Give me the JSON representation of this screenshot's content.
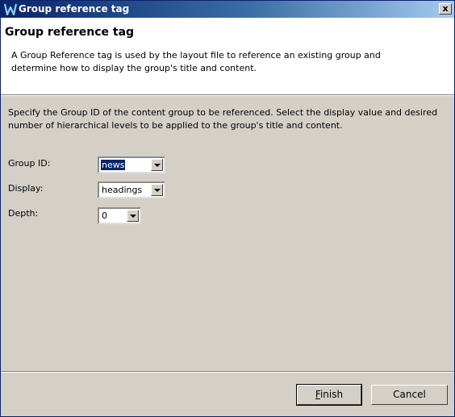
{
  "window": {
    "title": "Group reference tag",
    "close_label": "x"
  },
  "header": {
    "title": "Group reference tag",
    "description": "A Group Reference tag is used by the layout file to reference an existing group and determine how to display the group's title and content."
  },
  "instructions": "Specify the Group ID of the content group to be referenced. Select the display value and desired number of hierarchical levels to be applied to the group's title and content.",
  "fields": {
    "group_id": {
      "label": "Group ID:",
      "value": "news"
    },
    "display": {
      "label": "Display:",
      "value": "headings"
    },
    "depth": {
      "label": "Depth:",
      "value": "0"
    }
  },
  "buttons": {
    "finish_prefix": "",
    "finish_mnemonic": "F",
    "finish_rest": "inish",
    "cancel": "Cancel"
  },
  "colors": {
    "titlebar_start": "#0a246a",
    "titlebar_end": "#a6caf0",
    "dialog_bg": "#d4d0c8",
    "selection": "#0a246a"
  }
}
